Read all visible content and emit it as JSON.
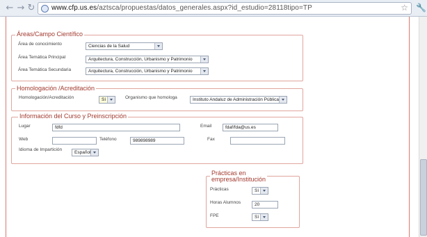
{
  "browser": {
    "back_icon": "back-arrow-icon",
    "forward_icon": "forward-arrow-icon",
    "url_host": "www.cfp.us.es",
    "url_path": "/aztsca/propuestas/datos_generales.aspx?id_estudio=28118tipo=TP"
  },
  "areas": {
    "legend": "Áreas/Campo Científico",
    "area_label": "Área de conocimiento",
    "area_value": "Ciencias de la Salud",
    "tematica_principal_label": "Área Temática Principal",
    "tematica_principal_value": "Arquitectura, Construcción, Urbanismo y Patrimonio",
    "tematica_secundaria_label": "Área Temática Secundaria",
    "tematica_secundaria_value": "Arquitectura, Construcción, Urbanismo y Patrimonio"
  },
  "homologacion": {
    "legend": "Homologación /Acreditación",
    "homologacion_label": "Homologación/Acreditación",
    "homologacion_value": "Sí",
    "organismo_label": "Organismo que homologa",
    "organismo_value": "Instituto Andaluz de Administración Pública"
  },
  "informacion": {
    "legend": "Información del Curso y Preinscripción",
    "lugar_label": "Lugar",
    "lugar_value": "fdfd",
    "email_label": "Email",
    "email_value": "fdaf/fda@us.es",
    "web_label": "Web",
    "web_value": "",
    "telefono_label": "Teléfono",
    "telefono_value": "989898989",
    "fax_label": "Fax",
    "fax_value": "",
    "idioma_label": "Idioma de Impartición",
    "idioma_value": "Español"
  },
  "practicas": {
    "legend_line1": "Prácticas en",
    "legend_line2": "empresa/Institución",
    "practicas_label": "Prácticas",
    "practicas_value": "Sí",
    "horas_label": "Horas Alumnos",
    "horas_value": "20",
    "fpe_label": "FPE",
    "fpe_value": "Sí"
  }
}
